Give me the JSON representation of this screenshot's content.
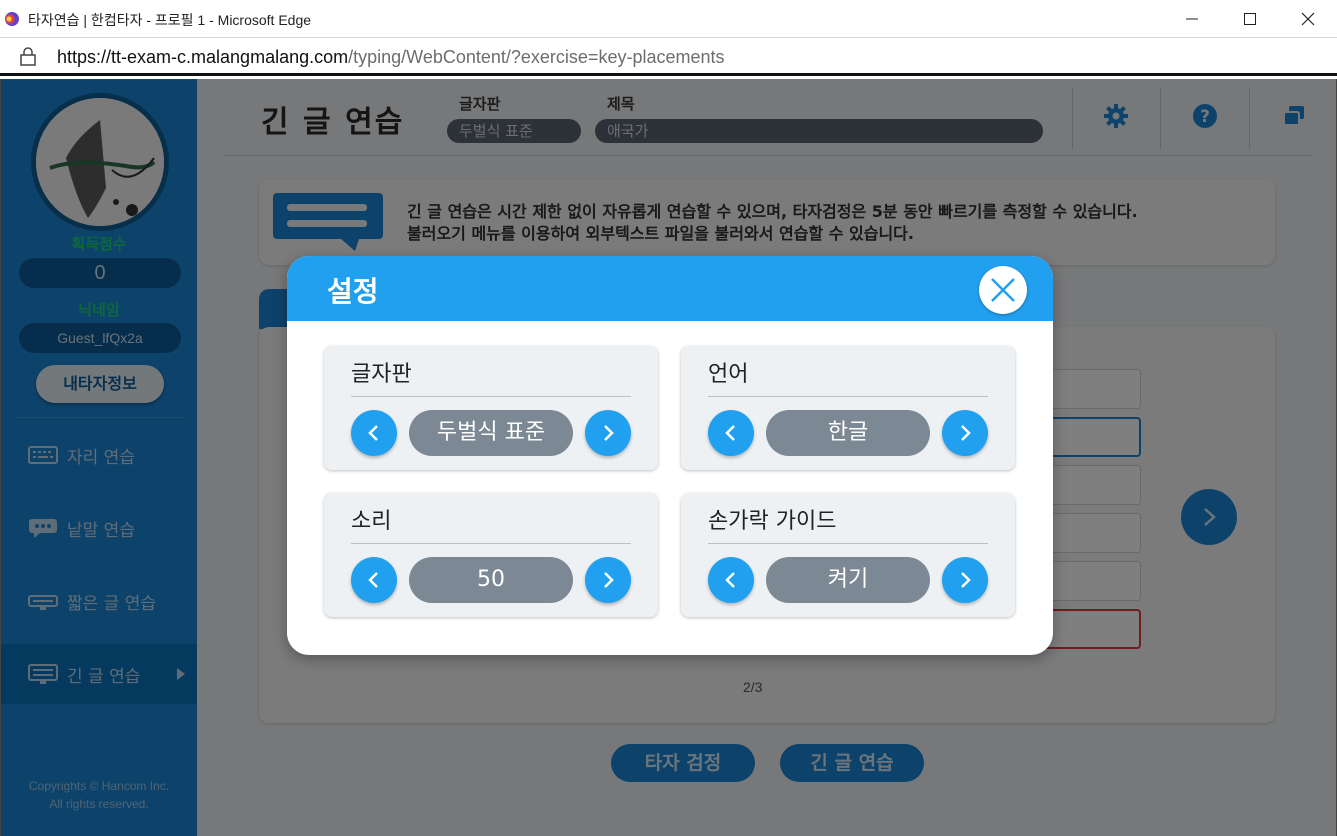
{
  "window": {
    "title": "타자연습 | 한컴타자 - 프로필 1 - Microsoft Edge",
    "url_host": "https://tt-exam-c.malangmalang.com",
    "url_path": "/typing/WebContent/?exercise=key-placements"
  },
  "sidebar": {
    "score_label": "획득점수",
    "score_value": "0",
    "nickname_label": "닉네임",
    "nickname_value": "Guest_lfQx2a",
    "my_info_button": "내타자정보",
    "menu": [
      {
        "label": "자리 연습",
        "icon": "keyboard-icon"
      },
      {
        "label": "낱말 연습",
        "icon": "speech-bubble-icon"
      },
      {
        "label": "짧은 글 연습",
        "icon": "short-text-icon"
      },
      {
        "label": "긴 글 연습",
        "icon": "long-text-icon",
        "active": true
      }
    ],
    "copyright_line1": "Copyrights © Hancom Inc.",
    "copyright_line2": "All rights reserved."
  },
  "header": {
    "title": "긴 글 연습",
    "layout_label": "글자판",
    "layout_value": "두벌식 표준",
    "subject_label": "제목",
    "subject_value": "애국가",
    "icons": [
      "gear-icon",
      "help-icon",
      "window-icon"
    ]
  },
  "info": {
    "line1": "긴 글 연습은 시간 제한 없이 자유롭게 연습할 수 있으며, 타자검정은 5분 동안 빠르기를 측정할 수 있습니다.",
    "line2": "불러오기 메뉴를 이용하여 외부텍스트 파일을 불러와서 연습할 수 있습니다."
  },
  "panel": {
    "page": "2/3"
  },
  "bottom_buttons": {
    "test": "타자 검정",
    "long_text": "긴 글 연습"
  },
  "modal": {
    "title": "설정",
    "cards": [
      {
        "title": "글자판",
        "value": "두벌식 표준"
      },
      {
        "title": "언어",
        "value": "한글"
      },
      {
        "title": "소리",
        "value": "50"
      },
      {
        "title": "손가락 가이드",
        "value": "켜기"
      }
    ]
  },
  "colors": {
    "brand_blue": "#1a86d6",
    "modal_blue": "#22a0f0",
    "pill_gray": "#7c8893"
  }
}
